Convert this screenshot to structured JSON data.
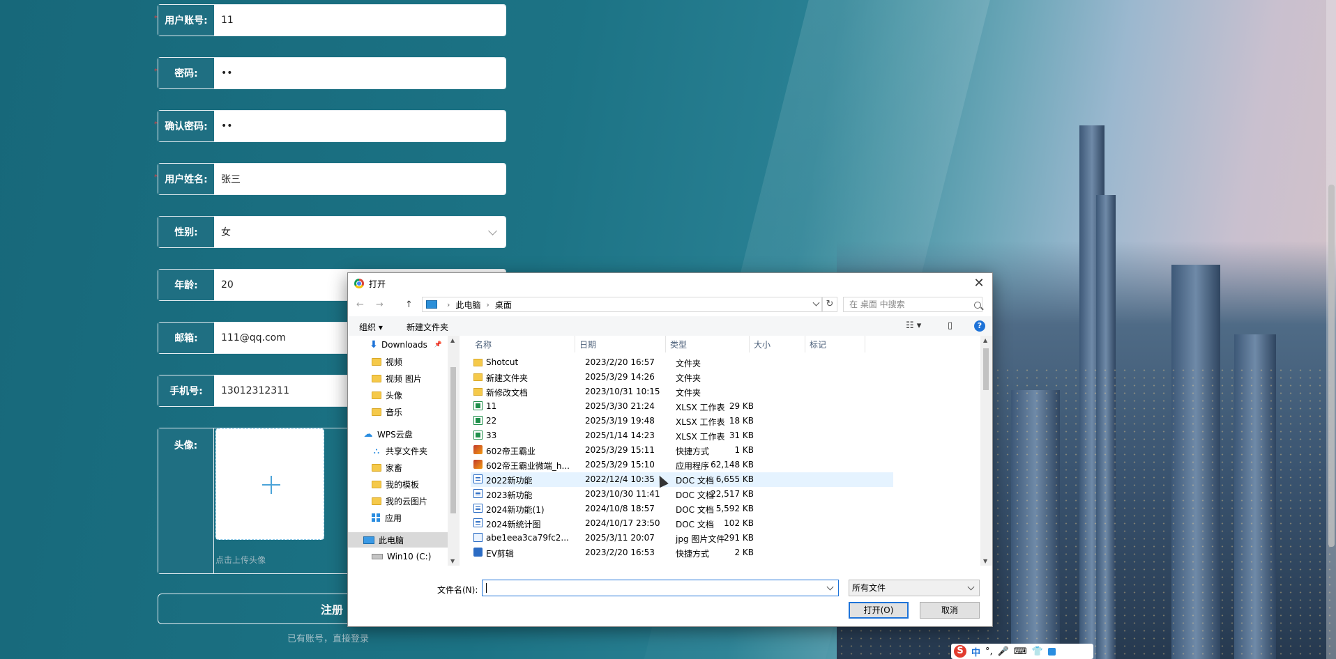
{
  "form": {
    "fields": [
      {
        "label": "用户账号:",
        "value": "11",
        "required": true
      },
      {
        "label": "密码:",
        "value": "••",
        "required": true
      },
      {
        "label": "确认密码:",
        "value": "••",
        "required": true
      },
      {
        "label": "用户姓名:",
        "value": "张三",
        "required": true
      },
      {
        "label": "性别:",
        "value": "女",
        "required": false
      },
      {
        "label": "年龄:",
        "value": "20",
        "required": false
      },
      {
        "label": "邮箱:",
        "value": "111@qq.com",
        "required": false
      },
      {
        "label": "手机号:",
        "value": "13012312311",
        "required": false
      }
    ],
    "avatar_label": "头像:",
    "avatar_tip": "点击上传头像",
    "plus_icon": "plus-icon",
    "register_label": "注册",
    "login_link": "已有账号，直接登录",
    "required_mark": "*"
  },
  "dialog": {
    "title": "打开",
    "close": "✕",
    "nav": {
      "back": "←",
      "forward": "→",
      "up": "↑"
    },
    "breadcrumb": [
      "此电脑",
      "桌面"
    ],
    "breadcrumb_sep": "›",
    "refresh": "↻",
    "search_placeholder": "在 桌面 中搜索",
    "toolbar": {
      "organize": "组织 ▾",
      "new_folder": "新建文件夹",
      "view": "☷ ▾",
      "pane": "▯",
      "help": "?"
    },
    "tree": [
      {
        "label": "Downloads",
        "icon": "download-icon",
        "pin": "📌"
      },
      {
        "label": "视频",
        "icon": "folder-icon"
      },
      {
        "label": "视频 图片",
        "icon": "folder-icon"
      },
      {
        "label": "头像",
        "icon": "folder-icon"
      },
      {
        "label": "音乐",
        "icon": "folder-icon"
      },
      {
        "label": "WPS云盘",
        "icon": "cloud-icon"
      },
      {
        "label": "共享文件夹",
        "icon": "share-icon"
      },
      {
        "label": "家畜",
        "icon": "folder-icon"
      },
      {
        "label": "我的模板",
        "icon": "folder-icon"
      },
      {
        "label": "我的云图片",
        "icon": "folder-icon"
      },
      {
        "label": "应用",
        "icon": "apps-icon"
      },
      {
        "label": "此电脑",
        "icon": "computer-icon",
        "selected": true
      },
      {
        "label": "Win10 (C:)",
        "icon": "disk-icon"
      }
    ],
    "columns": [
      "名称",
      "日期",
      "类型",
      "大小",
      "标记"
    ],
    "files": [
      {
        "name": "Shotcut",
        "date": "2023/2/20 16:57",
        "type": "文件夹",
        "size": "",
        "icon": "folder"
      },
      {
        "name": "新建文件夹",
        "date": "2025/3/29 14:26",
        "type": "文件夹",
        "size": "",
        "icon": "folder"
      },
      {
        "name": "新修改文档",
        "date": "2023/10/31 10:15",
        "type": "文件夹",
        "size": "",
        "icon": "folder"
      },
      {
        "name": "11",
        "date": "2025/3/30 21:24",
        "type": "XLSX 工作表",
        "size": "29 KB",
        "icon": "xlsx"
      },
      {
        "name": "22",
        "date": "2025/3/19 19:48",
        "type": "XLSX 工作表",
        "size": "18 KB",
        "icon": "xlsx"
      },
      {
        "name": "33",
        "date": "2025/1/14 14:23",
        "type": "XLSX 工作表",
        "size": "31 KB",
        "icon": "xlsx"
      },
      {
        "name": "602帝王霸业",
        "date": "2025/3/29 15:11",
        "type": "快捷方式",
        "size": "1 KB",
        "icon": "app"
      },
      {
        "name": "602帝王霸业微端_h...",
        "date": "2025/3/29 15:10",
        "type": "应用程序",
        "size": "62,148 KB",
        "icon": "app"
      },
      {
        "name": "2022新功能",
        "date": "2022/12/4 10:35",
        "type": "DOC 文档",
        "size": "6,655 KB",
        "icon": "doc",
        "hover": true
      },
      {
        "name": "2023新功能",
        "date": "2023/10/30 11:41",
        "type": "DOC 文档",
        "size": "22,517 KB",
        "icon": "doc"
      },
      {
        "name": "2024新功能(1)",
        "date": "2024/10/8 18:57",
        "type": "DOC 文档",
        "size": "5,592 KB",
        "icon": "doc"
      },
      {
        "name": "2024新统计图",
        "date": "2024/10/17 23:50",
        "type": "DOC 文档",
        "size": "102 KB",
        "icon": "doc"
      },
      {
        "name": "abe1eea3ca79fc2...",
        "date": "2025/3/11 20:07",
        "type": "jpg 图片文件",
        "size": "291 KB",
        "icon": "jpg"
      },
      {
        "name": "EV剪辑",
        "date": "2023/2/20 16:53",
        "type": "快捷方式",
        "size": "2 KB",
        "icon": "ev"
      }
    ],
    "filename_label": "文件名(N):",
    "filename_value": "",
    "filetype": "所有文件",
    "open_button": "打开(O)",
    "cancel_button": "取消"
  },
  "ime": {
    "logo": "S",
    "mode": "中",
    "punct": "°,",
    "mic": "🎤",
    "keyboard": "⌨",
    "skin": "👕"
  }
}
